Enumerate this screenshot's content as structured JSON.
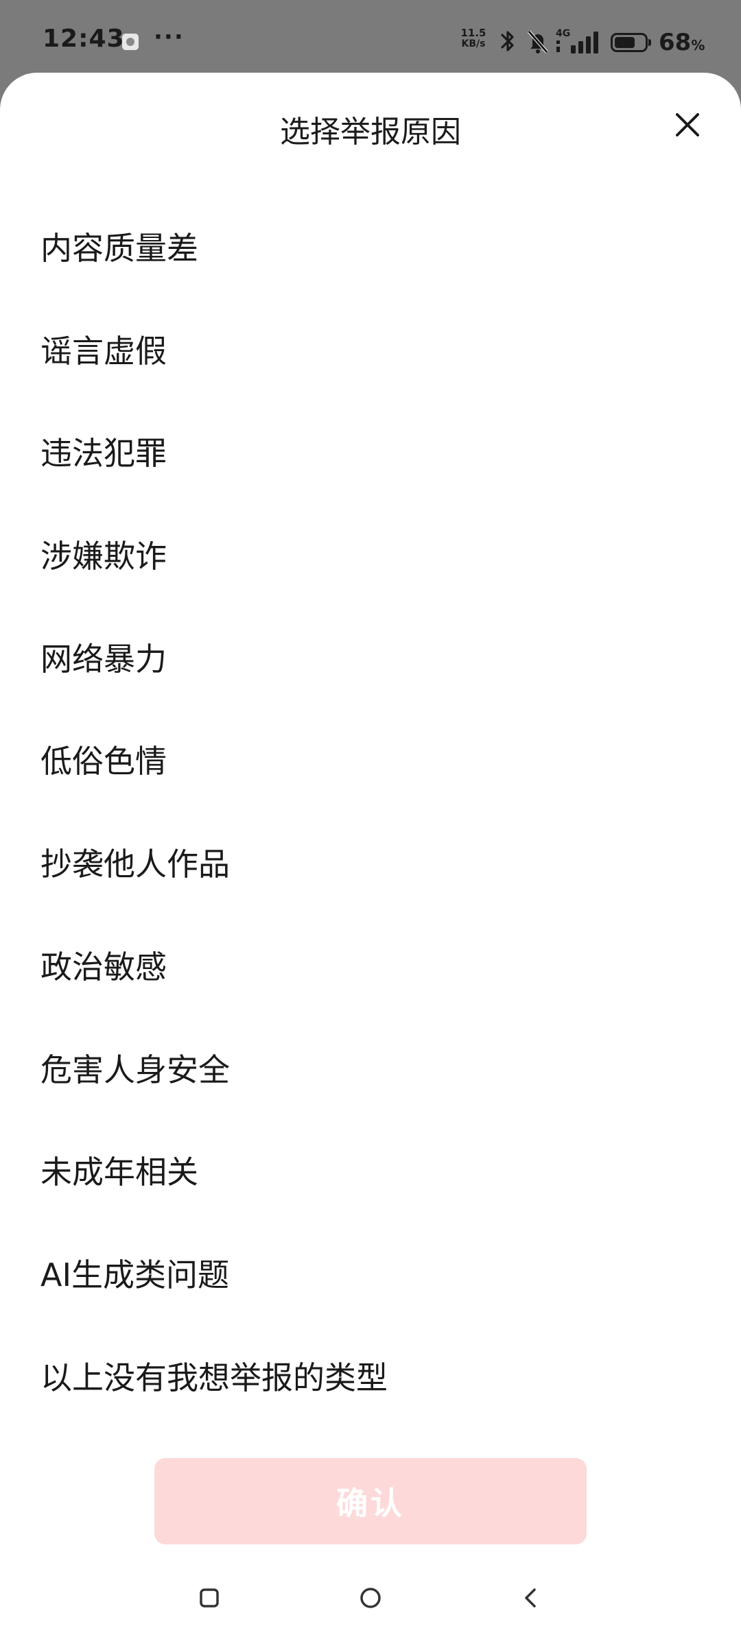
{
  "status_bar": {
    "time": "12:43",
    "more": "···",
    "net_speed_value": "11.5",
    "net_speed_unit": "KB/s",
    "network": "4G",
    "battery_pct": "68",
    "battery_pct_sign": "%",
    "battery_level": 0.68,
    "icons": [
      "app-notification-icon",
      "bluetooth-icon",
      "mute-bell-icon",
      "signal-4g-icon",
      "battery-icon"
    ]
  },
  "sheet": {
    "title": "选择举报原因",
    "close_icon": "close-icon",
    "reasons": [
      "内容质量差",
      "谣言虚假",
      "违法犯罪",
      "涉嫌欺诈",
      "网络暴力",
      "低俗色情",
      "抄袭他人作品",
      "政治敏感",
      "危害人身安全",
      "未成年相关",
      "AI生成类问题",
      "以上没有我想举报的类型"
    ],
    "confirm_label": "确认",
    "confirm_color": "#fdd9da"
  },
  "nav_bar": {
    "icons": [
      "recent-apps-icon",
      "home-icon",
      "back-icon"
    ]
  }
}
